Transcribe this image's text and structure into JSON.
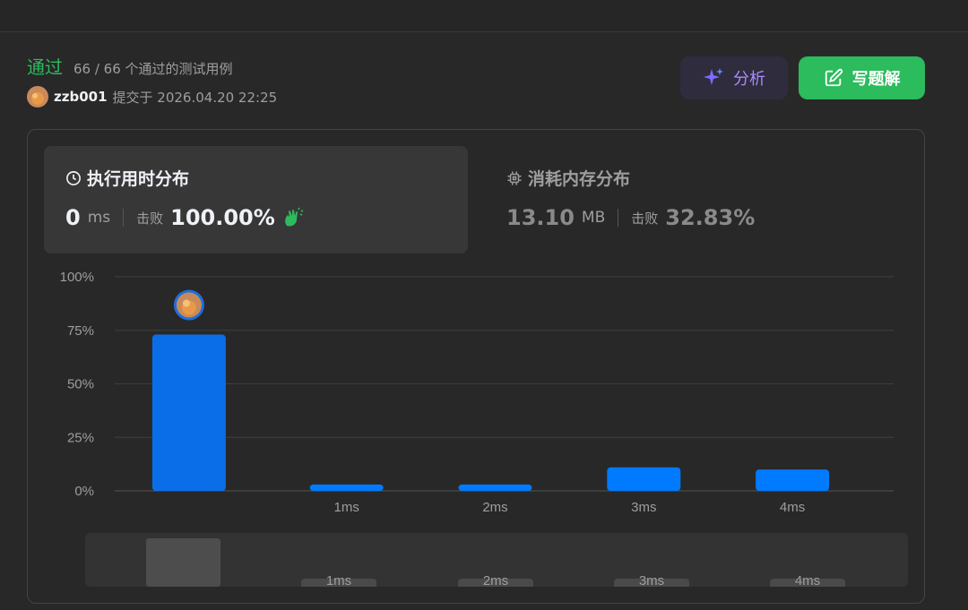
{
  "status": {
    "title": "通过",
    "cases": "66 / 66 个通过的测试用例"
  },
  "submission": {
    "username": "zzb001",
    "submitted_at": "提交于 2026.04.20 22:25"
  },
  "buttons": {
    "analyze": "分析",
    "write_solution": "写题解"
  },
  "runtime": {
    "label": "执行用时分布",
    "value": "0",
    "unit": "ms",
    "beats_label": "击败",
    "beats": "100.00%"
  },
  "memory": {
    "label": "消耗内存分布",
    "value": "13.10",
    "unit": "MB",
    "beats_label": "击败",
    "beats": "32.83%"
  },
  "colors": {
    "accent_green": "#2cbb5d",
    "bar_blue": "#007aff",
    "analyze_purple": "#a98bff"
  },
  "chart_data": {
    "type": "bar",
    "categories": [
      "",
      "1ms",
      "2ms",
      "3ms",
      "4ms"
    ],
    "values": [
      73,
      3,
      3,
      11,
      10
    ],
    "y_ticks": [
      "100%",
      "75%",
      "50%",
      "25%",
      "0%"
    ],
    "ylim": [
      0,
      100
    ],
    "grid": true,
    "highlight_index": 0
  },
  "overview": {
    "labels": [
      "1ms",
      "2ms",
      "3ms",
      "4ms"
    ]
  }
}
